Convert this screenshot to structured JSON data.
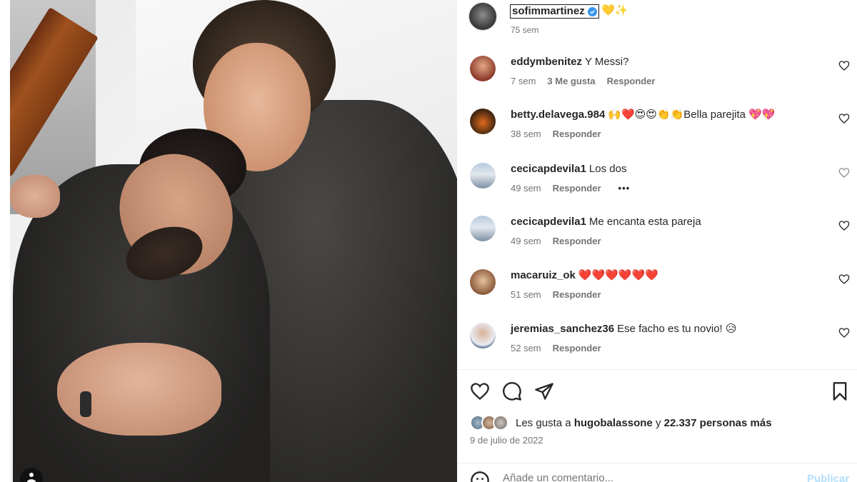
{
  "post": {
    "owner": {
      "username": "sofimmartinez",
      "suffix_emojis": "💛✨",
      "time": "75 sem"
    },
    "comments": [
      {
        "user": "eddymbenitez",
        "text": "Y Messi?",
        "time": "7 sem",
        "likes": "3 Me gusta",
        "reply": "Responder",
        "avatar_color": "#b0523f"
      },
      {
        "user": "betty.delavega.984",
        "text": "🙌❤️😍😍👏👏Bella parejita 💖💖",
        "time": "38 sem",
        "reply": "Responder",
        "avatar_color": "#6a3f1f"
      },
      {
        "user": "cecicapdevila1",
        "text": "Los dos",
        "time": "49 sem",
        "reply": "Responder",
        "more": "•••",
        "avatar_color": "#8aa3c0"
      },
      {
        "user": "cecicapdevila1",
        "text": "Me encanta esta pareja",
        "time": "49 sem",
        "reply": "Responder",
        "avatar_color": "#8aa3c0"
      },
      {
        "user": "macaruiz_ok",
        "text": "❤️❤️❤️❤️❤️❤️",
        "time": "51 sem",
        "reply": "Responder",
        "avatar_color": "#c9956c"
      },
      {
        "user": "jeremias_sanchez36",
        "text": "Ese facho es tu novio! 😥",
        "time": "52 sem",
        "reply": "Responder",
        "avatar_color": "#5a6b8a"
      }
    ],
    "likes": {
      "prefix": "Les gusta a",
      "first_user": "hugobalassone",
      "connector": "y",
      "others": "22.337 personas más"
    },
    "date": "9 de julio de 2022",
    "add_comment": {
      "placeholder": "Añade un comentario...",
      "publish_label": "Publicar"
    }
  },
  "icons": {
    "like": "heart-icon",
    "comment": "comment-icon",
    "share": "share-icon",
    "save": "bookmark-icon",
    "emoji": "smile-icon",
    "verified": "verified-badge-icon"
  },
  "colors": {
    "verified": "#3797f0",
    "text": "#262626",
    "muted": "#737373",
    "publish_disabled": "#b2dffc"
  }
}
